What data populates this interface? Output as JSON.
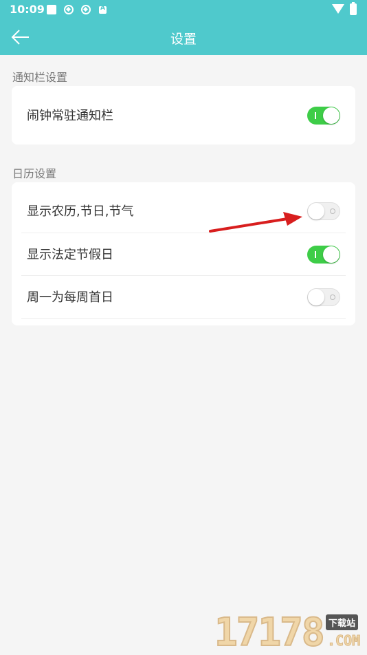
{
  "status_bar": {
    "time": "10:09"
  },
  "header": {
    "title": "设置",
    "background_color": "#4fc9cc"
  },
  "sections": {
    "notification": {
      "title": "通知栏设置",
      "items": [
        {
          "label": "闹钟常驻通知栏",
          "enabled": true
        }
      ]
    },
    "calendar": {
      "title": "日历设置",
      "items": [
        {
          "label": "显示农历,节日,节气",
          "enabled": false
        },
        {
          "label": "显示法定节假日",
          "enabled": true
        },
        {
          "label": "周一为每周首日",
          "enabled": false
        }
      ]
    }
  },
  "colors": {
    "toggle_on": "#3ecd48",
    "toggle_off": "#f0f0f0",
    "annotation_arrow": "#e02020"
  },
  "watermark": {
    "digits": "17178",
    "tag": "下载站",
    "suffix": ".COM"
  }
}
